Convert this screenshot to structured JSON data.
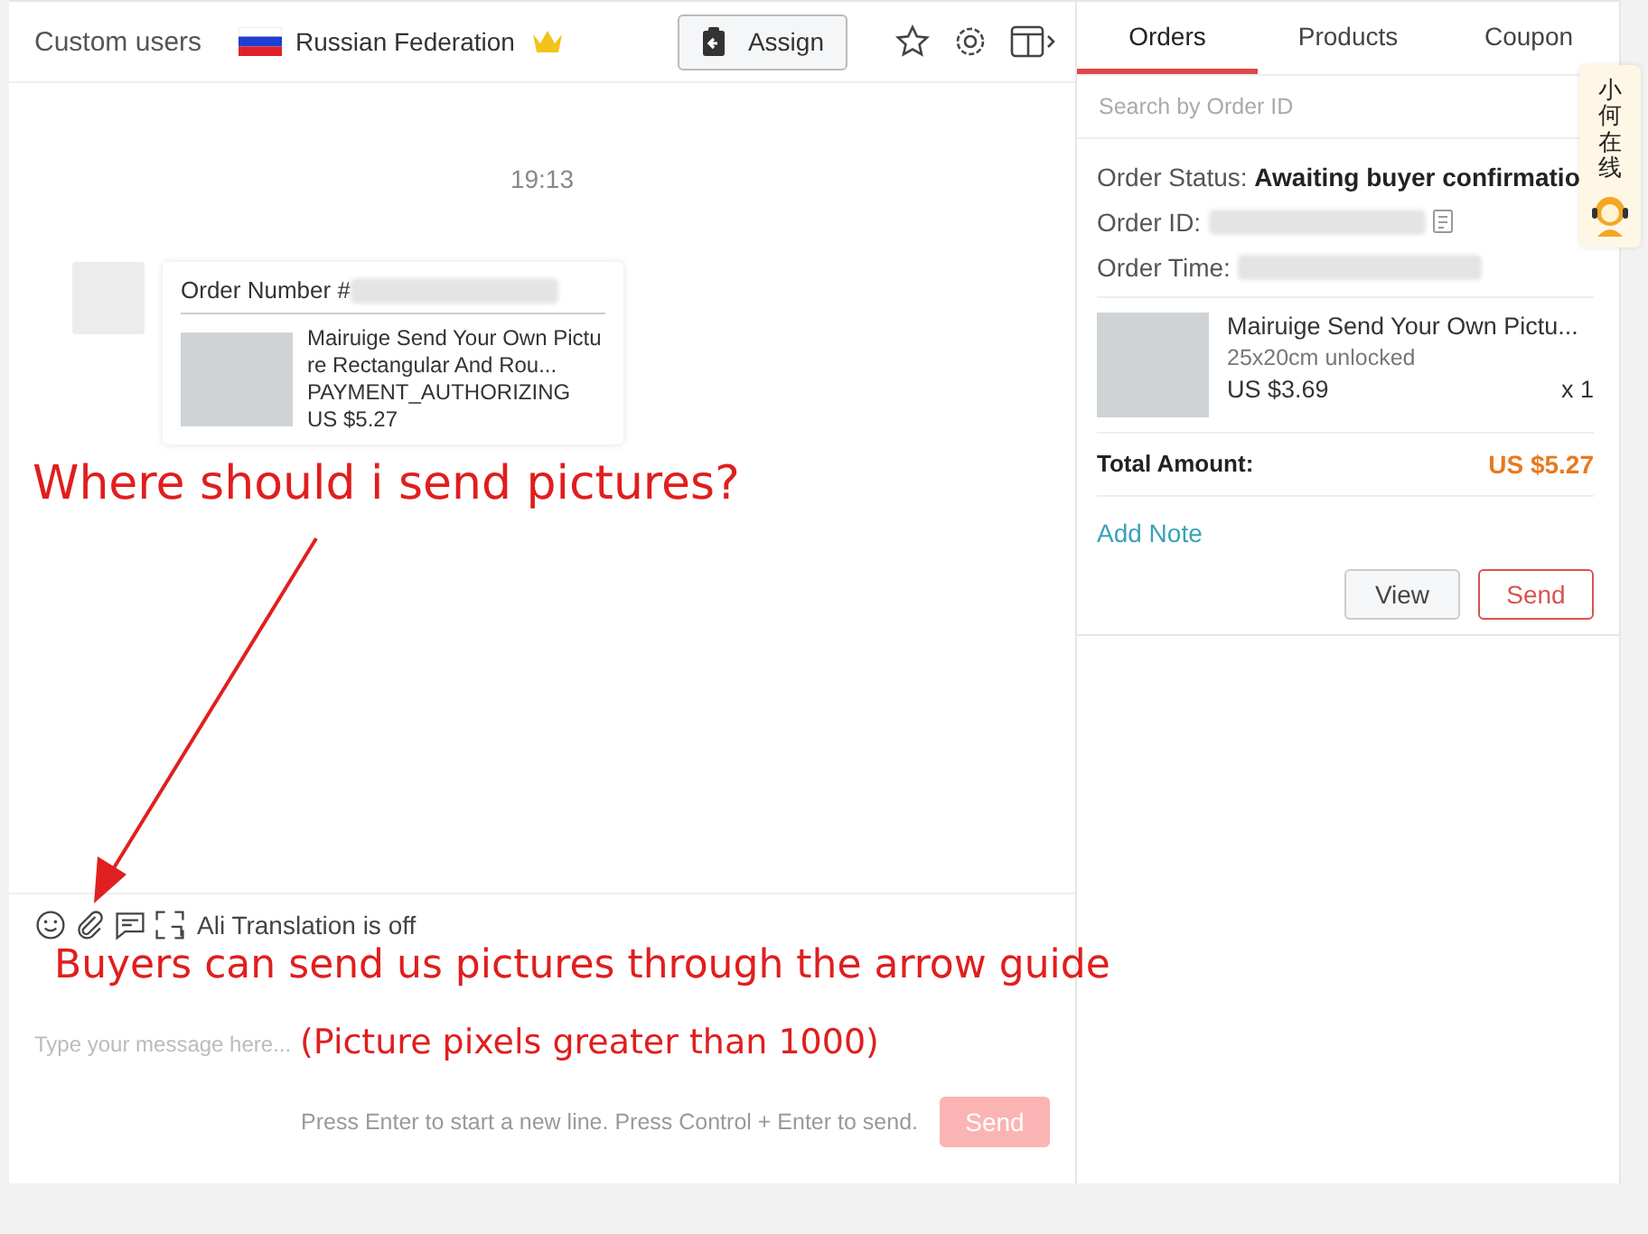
{
  "header": {
    "title": "Custom users",
    "country": "Russian Federation",
    "assign_button": "Assign"
  },
  "chat": {
    "time": "19:13",
    "order_card": {
      "number_label": "Order Number #",
      "product_title": "Mairuige Send Your Own Picture Rectangular And Rou...",
      "status": "PAYMENT_AUTHORIZING",
      "price": "US $5.27"
    },
    "toolbar": {
      "translation": "Ali Translation is off"
    },
    "input": {
      "placeholder": "Type your message here..."
    },
    "hint": "Press Enter to start a new line. Press Control + Enter to send.",
    "send_button": {
      "label": "Send",
      "disabled": true
    }
  },
  "tabs": [
    {
      "label": "Orders",
      "selected": true
    },
    {
      "label": "Products",
      "selected": false
    },
    {
      "label": "Coupon",
      "selected": false
    }
  ],
  "search": {
    "placeholder": "Search by Order ID"
  },
  "order": {
    "status_label": "Order Status:",
    "status": "Awaiting buyer confirmatio",
    "id_label": "Order ID:",
    "time_label": "Order Time:",
    "item": {
      "title": "Mairuige Send Your Own Pictu...",
      "variant": "25x20cm unlocked",
      "price": "US $3.69",
      "quantity": "x 1"
    },
    "total_label": "Total Amount:",
    "total": "US $5.27",
    "add_note": "Add Note",
    "buttons": [
      "View",
      "Send"
    ]
  },
  "helper": {
    "label": "小何在线"
  },
  "annotations": [
    {
      "text": "Where should i send pictures?"
    },
    {
      "text": "Buyers can send us pictures through the arrow guide"
    },
    {
      "text": "(Picture pixels greater than 1000)"
    }
  ]
}
